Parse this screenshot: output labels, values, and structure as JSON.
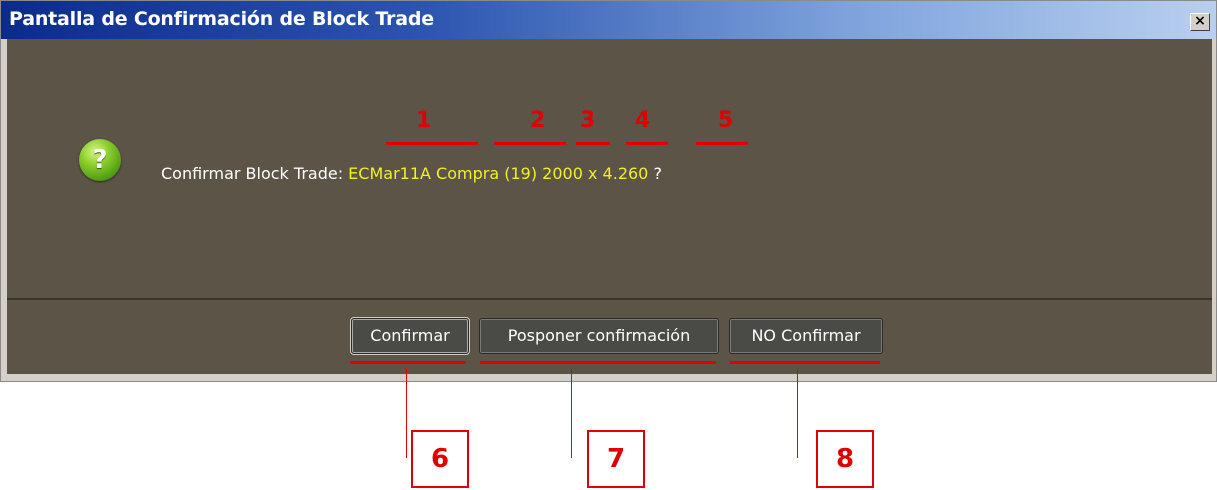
{
  "window": {
    "title": "Pantalla de Confirmación de Block Trade",
    "close_label": "×"
  },
  "message": {
    "prefix": "Confirmar Block Trade: ",
    "contract": "ECMar11A",
    "side": "Compra",
    "account": "(19)",
    "quantity": "2000",
    "separator": "x",
    "price": "4.260",
    "suffix": "?"
  },
  "icons": {
    "question": "?"
  },
  "buttons": {
    "confirm": "Confirmar",
    "postpone": "Posponer confirmación",
    "not_confirm": "NO Confirmar"
  },
  "annotations": {
    "field_numbers": [
      "1",
      "2",
      "3",
      "4",
      "5"
    ],
    "button_numbers": [
      "6",
      "7",
      "8"
    ]
  },
  "colors": {
    "annotation": "#e00000",
    "value_text": "#f2f02a",
    "panel_bg": "#5b5447"
  }
}
